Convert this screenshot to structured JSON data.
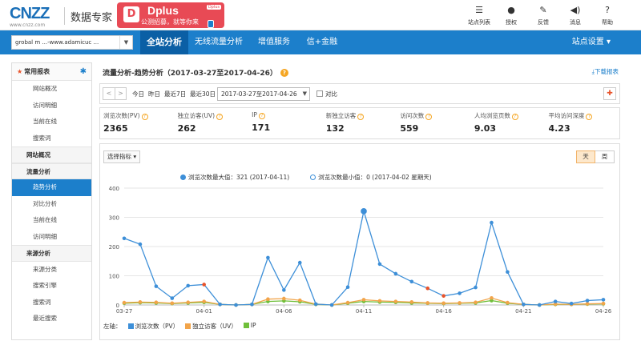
{
  "header": {
    "logo": "CNZZ",
    "logo_sub": "www.cnzz.com",
    "product": "数据专家",
    "promo": {
      "title": "Dplus",
      "tag": "Dplus",
      "subtitle": "公测招募，就等你来"
    },
    "actions": [
      {
        "label": "站点列表",
        "icon": "list-icon"
      },
      {
        "label": "授权",
        "icon": "user-icon"
      },
      {
        "label": "反馈",
        "icon": "edit-icon"
      },
      {
        "label": "消息",
        "icon": "speaker-icon"
      },
      {
        "label": "帮助",
        "icon": "help-icon"
      }
    ]
  },
  "nav": {
    "site": "grobal m ...-www.adamicuc ...",
    "tabs": [
      "全站分析",
      "无线流量分析",
      "增值服务",
      "信+金融"
    ],
    "settings": "站点设置 ▾"
  },
  "sidebar": {
    "head": "常用报表",
    "groups": [
      {
        "type": "item",
        "label": "网站概况"
      },
      {
        "type": "item",
        "label": "访问明细"
      },
      {
        "type": "item",
        "label": "当前在线"
      },
      {
        "type": "item",
        "label": "搜索词"
      },
      {
        "type": "group",
        "label": "网站概况"
      },
      {
        "type": "group",
        "label": "流量分析"
      },
      {
        "type": "item",
        "label": "趋势分析",
        "active": true
      },
      {
        "type": "item",
        "label": "对比分析"
      },
      {
        "type": "item",
        "label": "当前在线"
      },
      {
        "type": "item",
        "label": "访问明细"
      },
      {
        "type": "group",
        "label": "来源分析"
      },
      {
        "type": "item",
        "label": "来源分类"
      },
      {
        "type": "item",
        "label": "搜索引擎"
      },
      {
        "type": "item",
        "label": "搜索词"
      },
      {
        "type": "item",
        "label": "最近搜索"
      }
    ]
  },
  "main": {
    "title": "流量分析-趋势分析（2017-03-27至2017-04-26）",
    "download": "下载报表",
    "toolbar": {
      "today": "今日",
      "yesterday": "昨日",
      "last7": "最近7日",
      "last30": "最近30日",
      "range": "2017-03-27至2017-04-26",
      "compare": "对比"
    },
    "metrics": [
      {
        "label": "浏览次数(PV)",
        "value": "2365"
      },
      {
        "label": "独立访客(UV)",
        "value": "262"
      },
      {
        "label": "IP",
        "value": "171"
      },
      {
        "label": "新独立访客",
        "value": "132"
      },
      {
        "label": "访问次数",
        "value": "559"
      },
      {
        "label": "人均浏览页数",
        "value": "9.03"
      },
      {
        "label": "平均访问深度",
        "value": "4.23"
      }
    ],
    "metric_select": "选择指标 ▾",
    "toggle": [
      "天",
      "周"
    ],
    "legend_top": {
      "max": "浏览次数最大值：321 (2017-04-11)",
      "min": "浏览次数最小值：0 (2017-04-02 星期天)"
    },
    "legend_bottom": {
      "prefix": "左轴：",
      "items": [
        "浏览次数（PV）",
        "独立访客（UV）",
        "IP"
      ]
    }
  },
  "colors": {
    "accent": "#1c7fcb",
    "pv": "#3d8fd8",
    "uv": "#f2a44a",
    "ip": "#6fbf3a",
    "peak": "#e8532b"
  },
  "chart_data": {
    "type": "line",
    "x_ticks": [
      "03-27",
      "04-01",
      "04-06",
      "04-11",
      "04-16",
      "04-21",
      "04-26"
    ],
    "ylim": [
      0,
      400
    ],
    "yticks": [
      0,
      100,
      200,
      300,
      400
    ],
    "grid": true,
    "series": [
      {
        "name": "浏览次数（PV）",
        "values": [
          228,
          208,
          64,
          23,
          66,
          70,
          2,
          0,
          2,
          162,
          51,
          145,
          3,
          0,
          61,
          321,
          140,
          107,
          80,
          57,
          31,
          40,
          60,
          282,
          113,
          2,
          0,
          12,
          5,
          15,
          18
        ]
      },
      {
        "name": "独立访客（UV）",
        "values": [
          8,
          10,
          9,
          6,
          9,
          12,
          2,
          0,
          2,
          20,
          22,
          16,
          3,
          0,
          8,
          18,
          14,
          12,
          10,
          7,
          6,
          7,
          9,
          24,
          8,
          2,
          0,
          3,
          2,
          4,
          5
        ]
      },
      {
        "name": "IP",
        "values": [
          6,
          8,
          7,
          5,
          7,
          9,
          2,
          0,
          2,
          12,
          14,
          11,
          2,
          0,
          6,
          12,
          10,
          9,
          7,
          6,
          5,
          6,
          7,
          15,
          6,
          2,
          0,
          2,
          2,
          3,
          4
        ]
      }
    ],
    "highlight_indices": [
      5,
      19,
      20
    ]
  }
}
